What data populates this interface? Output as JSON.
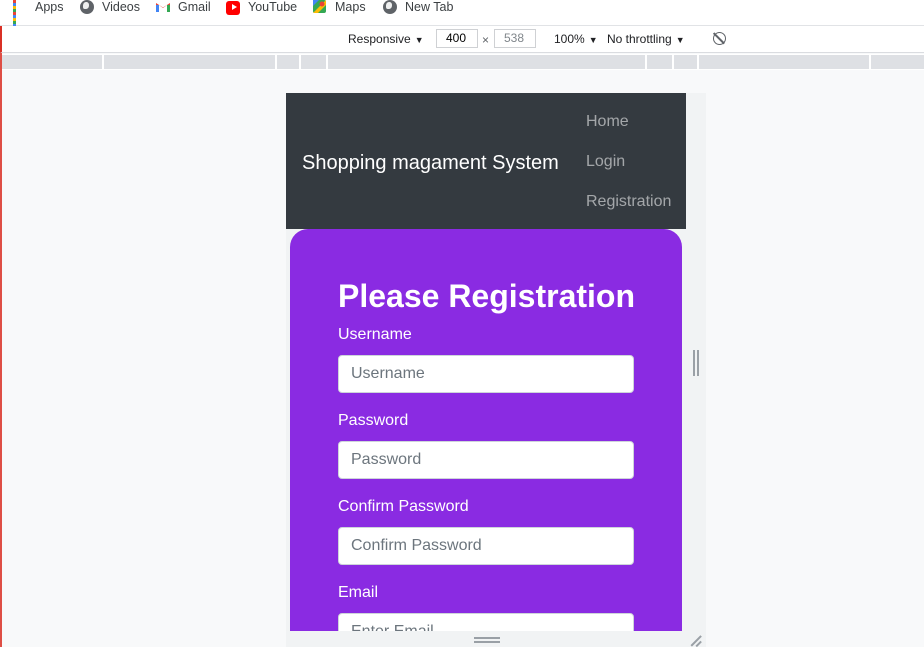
{
  "bookmarks": [
    {
      "label": "Apps",
      "icon": "apps-grid-icon"
    },
    {
      "label": "Videos",
      "icon": "globe-icon"
    },
    {
      "label": "Gmail",
      "icon": "gmail-icon"
    },
    {
      "label": "YouTube",
      "icon": "youtube-icon"
    },
    {
      "label": "Maps",
      "icon": "maps-icon"
    },
    {
      "label": "New Tab",
      "icon": "globe-icon"
    }
  ],
  "devtools": {
    "device": "Responsive",
    "width": "400",
    "height": "538",
    "zoom": "100%",
    "throttling": "No throttling",
    "dropdown_arrow": "▼",
    "times": "×"
  },
  "navbar": {
    "brand": "Shopping magament System",
    "links": [
      "Home",
      "Login",
      "Registration"
    ]
  },
  "form": {
    "title": "Please Registration",
    "fields": [
      {
        "label": "Username",
        "placeholder": "Username"
      },
      {
        "label": "Password",
        "placeholder": "Password"
      },
      {
        "label": "Confirm Password",
        "placeholder": "Confirm Password"
      },
      {
        "label": "Email",
        "placeholder": "Enter Email"
      }
    ]
  },
  "colors": {
    "navbar_bg": "#343a40",
    "card_bg": "#8a2be2",
    "devtools_border": "#d93025"
  }
}
